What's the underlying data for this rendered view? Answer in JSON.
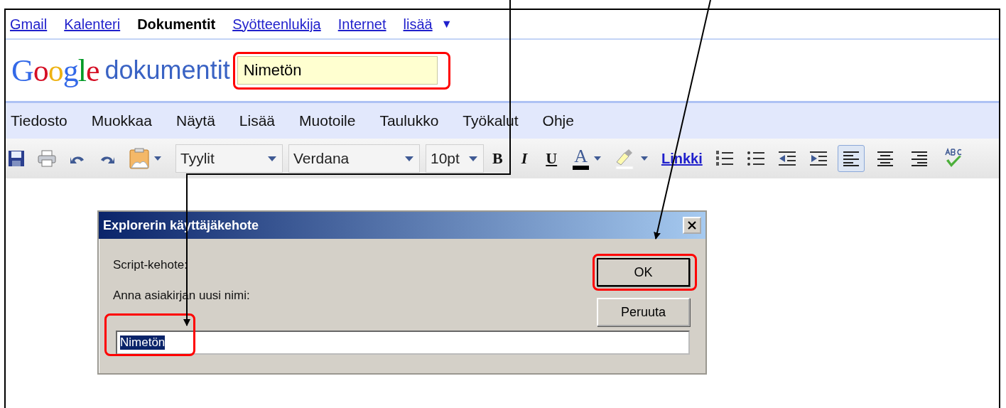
{
  "nav": [
    {
      "label": "Gmail",
      "selected": false
    },
    {
      "label": "Kalenteri",
      "selected": false
    },
    {
      "label": "Dokumentit",
      "selected": true
    },
    {
      "label": "Syötteenlukija",
      "selected": false
    },
    {
      "label": "Internet",
      "selected": false
    },
    {
      "label": "lisää",
      "selected": false
    }
  ],
  "nav_more_caret": "▼",
  "logo": {
    "letters": [
      "G",
      "o",
      "o",
      "g",
      "l",
      "e"
    ],
    "product": "dokumentit"
  },
  "title_field": {
    "value": "Nimetön",
    "highlighted": true
  },
  "menu": [
    "Tiedosto",
    "Muokkaa",
    "Näytä",
    "Lisää",
    "Muotoile",
    "Taulukko",
    "Työkalut",
    "Ohje"
  ],
  "toolbar": {
    "style_dropdown": "Tyylit",
    "font_dropdown": "Verdana",
    "size_dropdown": "10pt",
    "bold": "B",
    "italic": "I",
    "underline": "U",
    "text_color": "A",
    "link": "Linkki",
    "alignment": [
      {
        "selected": true
      },
      {
        "selected": false
      },
      {
        "selected": false
      }
    ]
  },
  "dialog": {
    "title": "Explorerin käyttäjäkehote",
    "prompt_label": "Script-kehote:",
    "message": "Anna asiakirjan uusi nimi:",
    "input_value": "Nimetön",
    "input_selected": true,
    "input_highlighted": true,
    "buttons": [
      {
        "label": "OK",
        "highlighted": true
      },
      {
        "label": "Peruuta",
        "highlighted": false
      }
    ]
  }
}
